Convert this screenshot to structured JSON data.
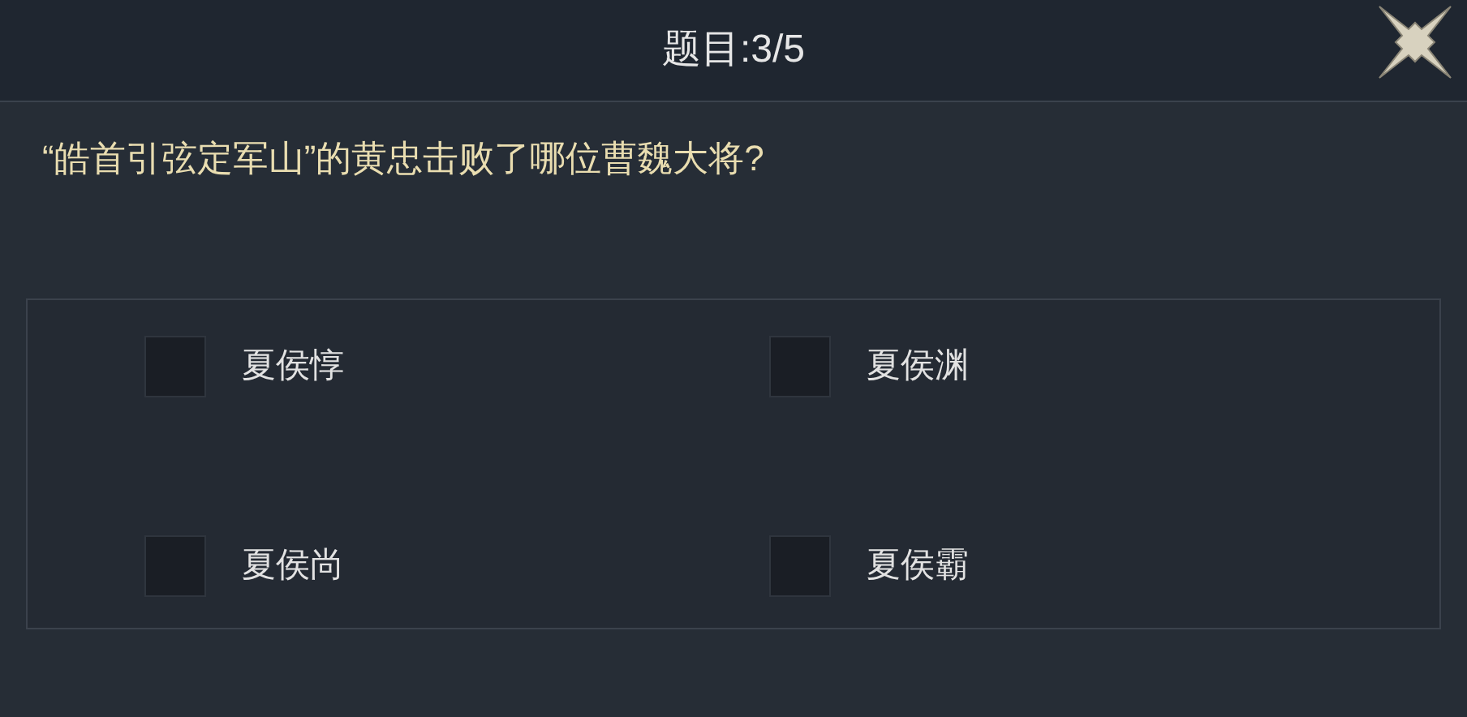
{
  "header": {
    "title": "题目:3/5"
  },
  "question": "“皓首引弦定军山”的黄忠击败了哪位曹魏大将?",
  "options": [
    {
      "label": "夏侯惇",
      "checked": false
    },
    {
      "label": "夏侯渊",
      "checked": false
    },
    {
      "label": "夏侯尚",
      "checked": false
    },
    {
      "label": "夏侯霸",
      "checked": false
    }
  ]
}
